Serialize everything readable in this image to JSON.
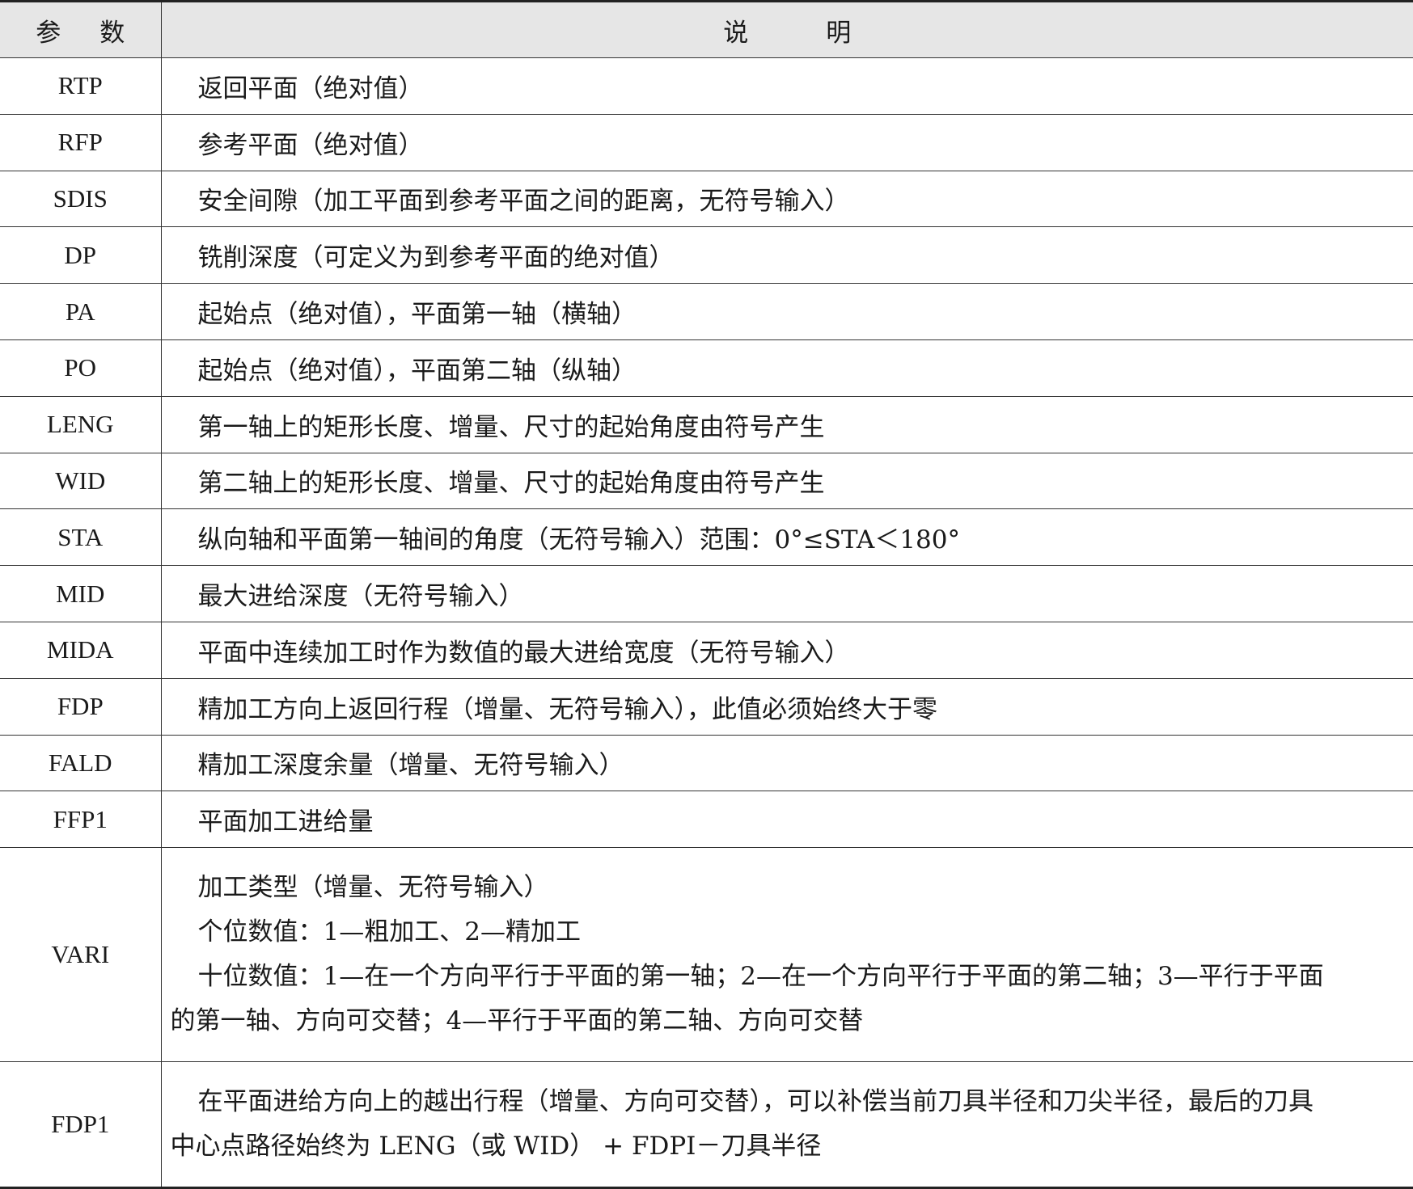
{
  "header": {
    "param_col": [
      "参",
      "数"
    ],
    "desc_col": [
      "说",
      "明"
    ]
  },
  "rows": [
    {
      "param": "RTP",
      "desc": "返回平面（绝对值）"
    },
    {
      "param": "RFP",
      "desc": "参考平面（绝对值）"
    },
    {
      "param": "SDIS",
      "desc": "安全间隙（加工平面到参考平面之间的距离，无符号输入）"
    },
    {
      "param": "DP",
      "desc": "铣削深度（可定义为到参考平面的绝对值）"
    },
    {
      "param": "PA",
      "desc": "起始点（绝对值），平面第一轴（横轴）"
    },
    {
      "param": "PO",
      "desc": "起始点（绝对值），平面第二轴（纵轴）"
    },
    {
      "param": "LENG",
      "desc": "第一轴上的矩形长度、增量、尺寸的起始角度由符号产生"
    },
    {
      "param": "WID",
      "desc": "第二轴上的矩形长度、增量、尺寸的起始角度由符号产生"
    },
    {
      "param": "STA",
      "desc": "纵向轴和平面第一轴间的角度（无符号输入）范围：0°≤STA＜180°"
    },
    {
      "param": "MID",
      "desc": "最大进给深度（无符号输入）"
    },
    {
      "param": "MIDA",
      "desc": "平面中连续加工时作为数值的最大进给宽度（无符号输入）"
    },
    {
      "param": "FDP",
      "desc": "精加工方向上返回行程（增量、无符号输入），此值必须始终大于零"
    },
    {
      "param": "FALD",
      "desc": "精加工深度余量（增量、无符号输入）"
    },
    {
      "param": "FFP1",
      "desc": "平面加工进给量"
    }
  ],
  "vari": {
    "param": "VARI",
    "lines": [
      "加工类型（增量、无符号输入）",
      "个位数值：1—粗加工、2—精加工",
      "十位数值：1—在一个方向平行于平面的第一轴；2—在一个方向平行于平面的第二轴；3—平行于平面",
      "的第一轴、方向可交替；4—平行于平面的第二轴、方向可交替"
    ]
  },
  "fdp1": {
    "param": "FDP1",
    "lines": [
      "在平面进给方向上的越出行程（增量、方向可交替），可以补偿当前刀具半径和刀尖半径，最后的刀具",
      "中心点路径始终为 LENG（或 WID） + FDPI－刀具半径"
    ]
  }
}
